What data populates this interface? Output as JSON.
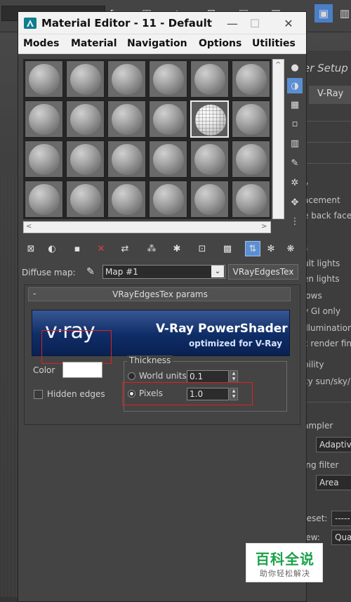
{
  "window": {
    "title": "Material Editor - 11 - Default",
    "title_controls": {
      "minimize": "—",
      "maximize": "☐",
      "close": "✕"
    }
  },
  "menu": [
    "Modes",
    "Material",
    "Navigation",
    "Options",
    "Utilities"
  ],
  "sample_slots": {
    "rows": 4,
    "columns": 6,
    "active_slot": {
      "row": 2,
      "column": 5
    }
  },
  "diffuse_map": {
    "label": "Diffuse map:",
    "map_name": "Map #1",
    "map_type": "VRayEdgesTex"
  },
  "rollout": {
    "collapse_symbol": "-",
    "title": "VRayEdgesTex params",
    "banner": {
      "logo": "v·ray",
      "title": "V-Ray PowerShader",
      "subtitle": "optimized for V-Ray"
    },
    "color": {
      "label": "Color",
      "value": "#ffffff"
    },
    "hidden_edges": {
      "label": "Hidden edges",
      "checked": false
    },
    "thickness": {
      "label": "Thickness",
      "world_units": {
        "label": "World units",
        "value": "0.1",
        "selected": false
      },
      "pixels": {
        "label": "Pixels",
        "value": "1.0",
        "selected": true
      }
    }
  },
  "render_setup_panel": {
    "title": "er Setup",
    "tab": "V-Ray",
    "lines": [
      "y",
      "acement",
      "e back face",
      "s",
      "ult lights",
      "en lights",
      "lows",
      "v GI only",
      "illumination",
      "c render fin",
      "bility",
      "cy sun/sky/",
      "ampler",
      "ing filter",
      "reset:",
      "iew:"
    ],
    "dropdowns": [
      "Adaptive",
      "Area",
      "-----",
      "Qua"
    ]
  },
  "watermark": {
    "main": "百科全说",
    "sub": "助你轻松解决"
  },
  "colors": {
    "highlight_box": "#e02020",
    "banner_blue": "#0f2d66",
    "watermark_green": "#1aa34a"
  }
}
